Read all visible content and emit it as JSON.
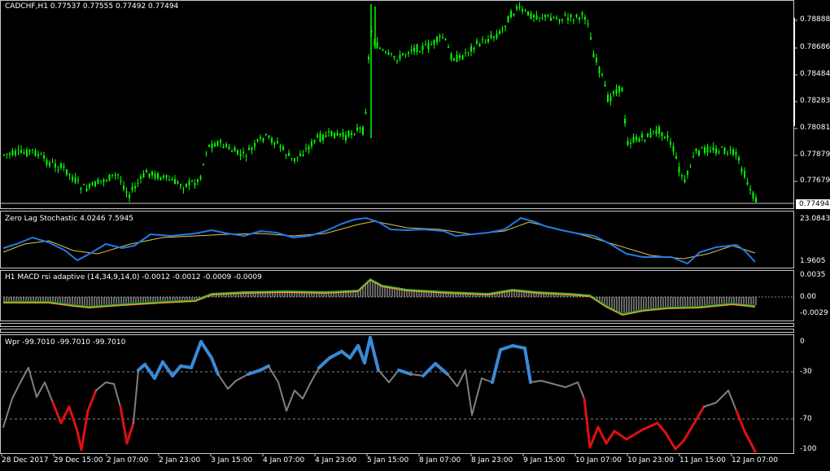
{
  "main": {
    "title": "CADCHF,H1  0.77537 0.77555 0.77492 0.77494",
    "price_ticks": [
      "0.78888",
      "0.78686",
      "0.78484",
      "0.78283",
      "0.78081",
      "0.77879",
      "0.77679"
    ],
    "current_price": "0.77494"
  },
  "stoch": {
    "title": "Zero Lag Stochastic 4.0246 7.5945",
    "ticks": [
      "23.0843",
      "1.9605"
    ]
  },
  "macd": {
    "title": "H1 MACD rsi adaptive (14,34,9,14,0) -0.0012 -0.0012 -0.0009 -0.0009",
    "ticks": [
      "0.0035",
      "0.00",
      "-0.0029"
    ]
  },
  "wpr": {
    "title": "Wpr -99.7010 -99.7010 -99.7010",
    "ticks": [
      "0",
      "-30",
      "-70",
      "-100"
    ]
  },
  "time_axis": [
    "28 Dec 2017",
    "29 Dec 15:00",
    "2 Jan 07:00",
    "2 Jan 23:00",
    "3 Jan 15:00",
    "4 Jan 07:00",
    "4 Jan 23:00",
    "5 Jan 15:00",
    "8 Jan 07:00",
    "8 Jan 23:00",
    "9 Jan 15:00",
    "10 Jan 07:00",
    "10 Jan 23:00",
    "11 Jan 15:00",
    "12 Jan 07:00"
  ],
  "colors": {
    "candles": "#00ff00",
    "stoch_main": "#1e7ce8",
    "stoch_signal": "#e8c04a",
    "macd_line": "#ff9933",
    "macd_signal": "#2db82d",
    "wpr_neutral": "#808080",
    "wpr_overbought": "#3a8ad6",
    "wpr_oversold": "#e01010"
  }
}
